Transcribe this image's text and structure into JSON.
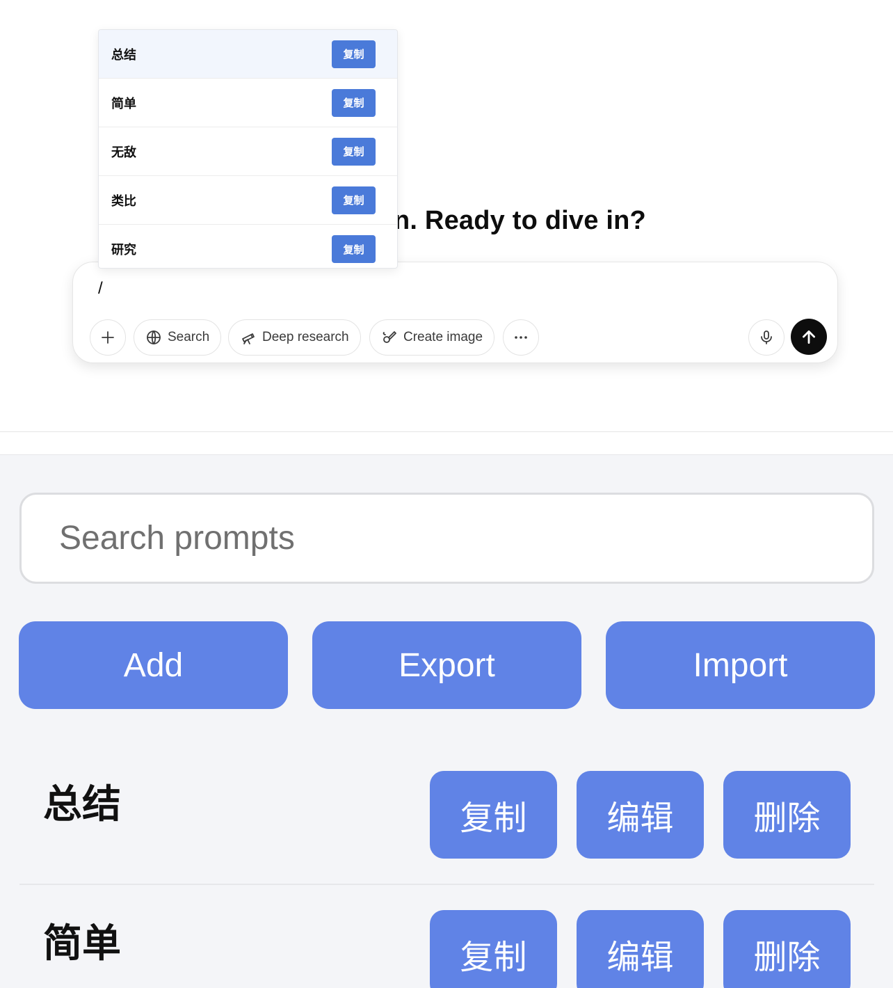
{
  "chat": {
    "headline": "n. Ready to dive in?",
    "composer_text": "/",
    "tools": [
      {
        "label": "Search",
        "icon": "globe-icon"
      },
      {
        "label": "Deep research",
        "icon": "telescope-icon"
      },
      {
        "label": "Create image",
        "icon": "brush-icon"
      }
    ]
  },
  "dropdown": {
    "items": [
      {
        "label": "总结",
        "action": "复制"
      },
      {
        "label": "简单",
        "action": "复制"
      },
      {
        "label": "无敌",
        "action": "复制"
      },
      {
        "label": "类比",
        "action": "复制"
      },
      {
        "label": "研究",
        "action": "复制"
      }
    ]
  },
  "manager": {
    "search_placeholder": "Search prompts",
    "buttons": {
      "add": "Add",
      "export": "Export",
      "import": "Import"
    },
    "prompts": [
      {
        "name": "总结",
        "copy": "复制",
        "edit": "编辑",
        "delete": "删除"
      },
      {
        "name": "简单",
        "copy": "复制",
        "edit": "编辑",
        "delete": "删除"
      }
    ]
  },
  "colors": {
    "accent": "#6083e6",
    "dropdown_button": "#4a7ad9",
    "send": "#0d0d0d"
  }
}
